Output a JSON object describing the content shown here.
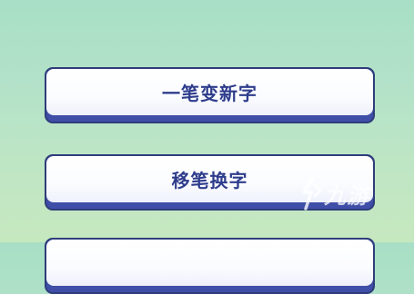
{
  "menu": {
    "items": [
      {
        "label": "一笔变新字"
      },
      {
        "label": "移笔换字"
      },
      {
        "label": ""
      }
    ]
  },
  "watermark": {
    "text": "九游",
    "icon": "jiuyou-logo-icon"
  },
  "colors": {
    "background_top": "#a8dfc6",
    "background_bottom": "#c6e8bf",
    "button_face": "#ffffff",
    "button_border": "#3f4fa8",
    "button_text": "#2e3c8c"
  }
}
